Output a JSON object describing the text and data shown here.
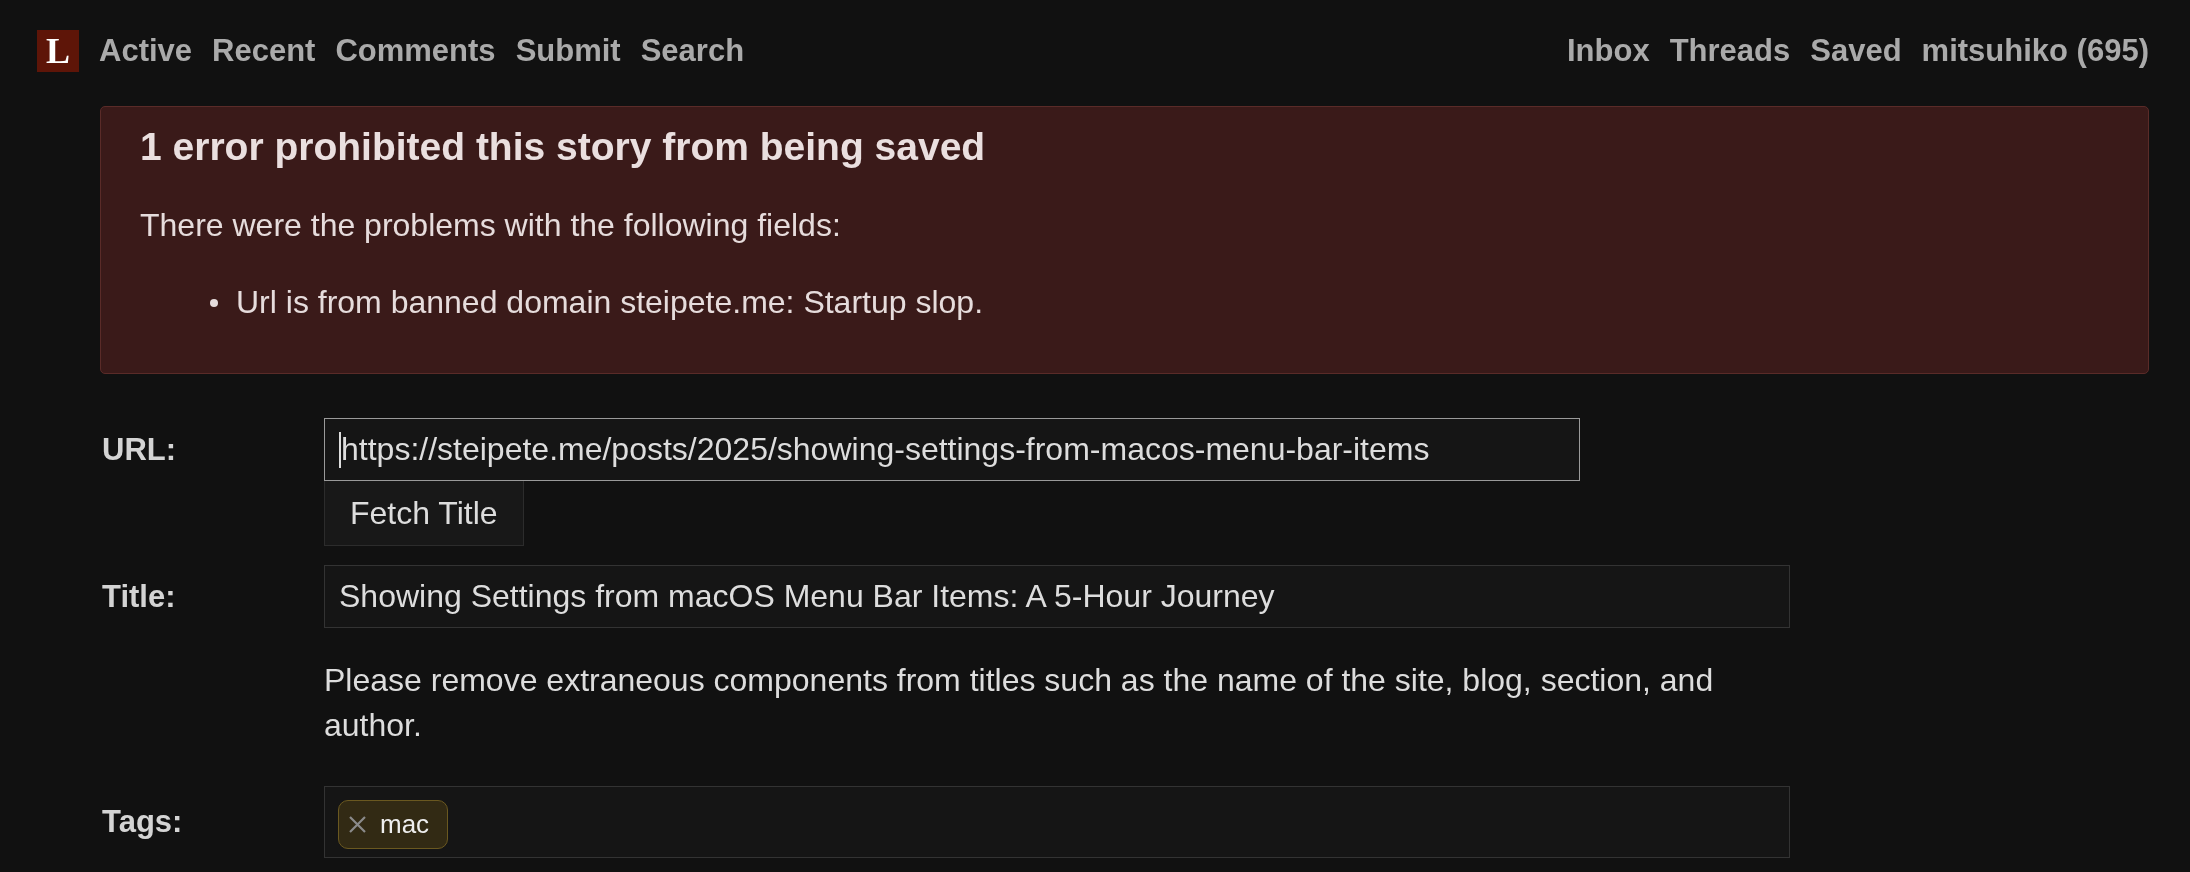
{
  "nav": {
    "logo": "L",
    "left": [
      "Active",
      "Recent",
      "Comments",
      "Submit",
      "Search"
    ],
    "right": [
      "Inbox",
      "Threads",
      "Saved",
      "mitsuhiko (695)"
    ]
  },
  "error": {
    "title": "1 error prohibited this story from being saved",
    "intro": "There were the problems with the following fields:",
    "items": [
      "Url is from banned domain steipete.me: Startup slop."
    ]
  },
  "form": {
    "fields": [
      {
        "kind": "url",
        "label": "URL:",
        "value": "https://steipete.me/posts/2025/showing-settings-from-macos-menu-bar-items",
        "focused": true,
        "button": "Fetch Title"
      },
      {
        "kind": "text",
        "label": "Title:",
        "value": "Showing Settings from macOS Menu Bar Items: A 5-Hour Journey",
        "focused": false,
        "hint": "Please remove extraneous components from titles such as the name of the site, blog, section, and author."
      },
      {
        "kind": "tags",
        "label": "Tags:",
        "tags": [
          "mac"
        ]
      }
    ]
  }
}
